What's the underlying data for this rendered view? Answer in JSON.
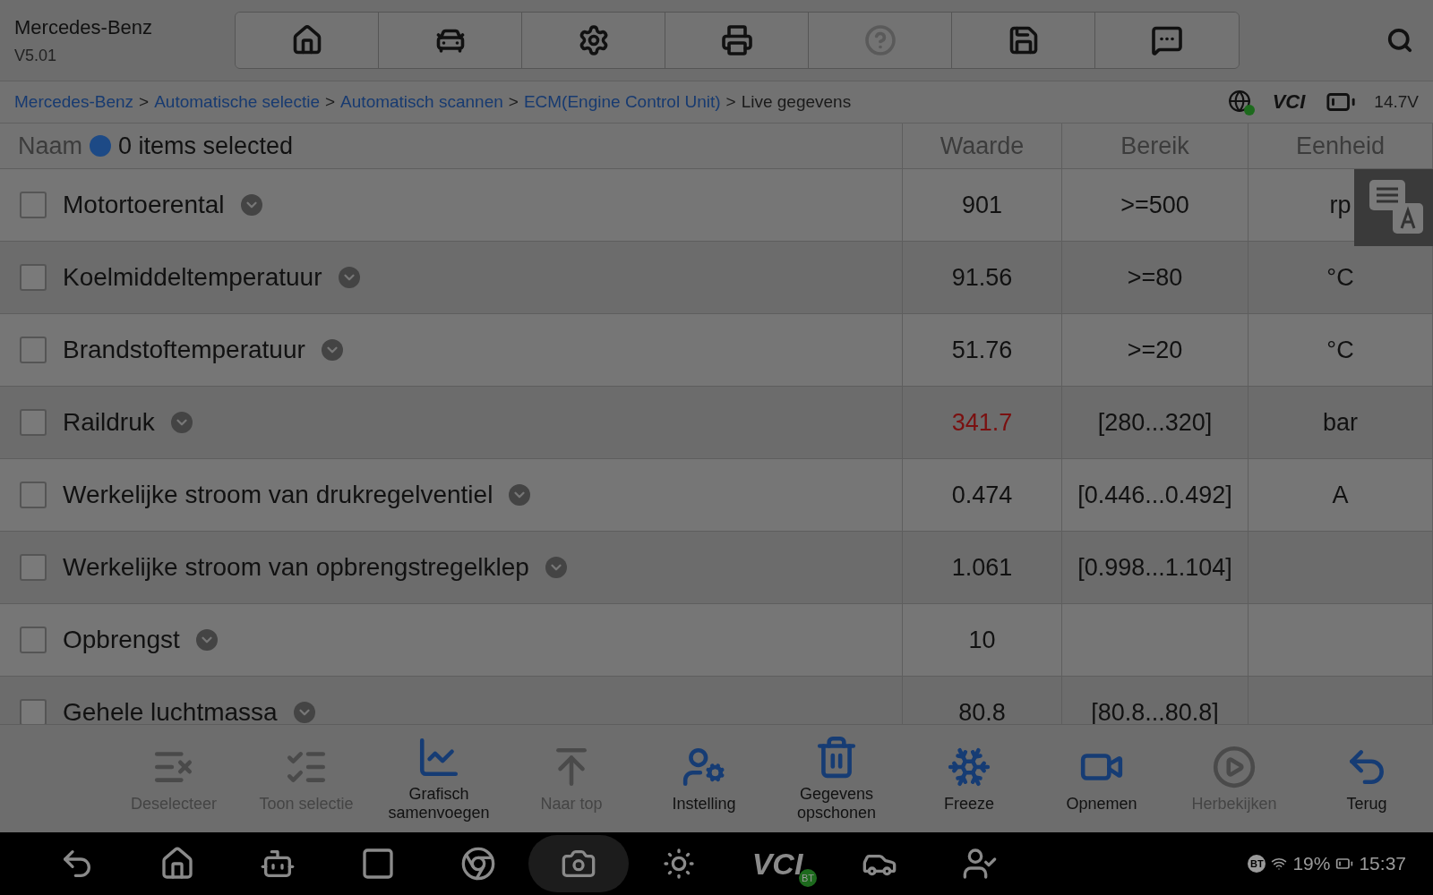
{
  "app": {
    "title": "Mercedes-Benz",
    "version": "V5.01"
  },
  "breadcrumb": {
    "links": [
      "Mercedes-Benz",
      "Automatische selectie",
      "Automatisch scannen",
      "ECM(Engine Control Unit)"
    ],
    "current": "Live gegevens",
    "separator": ">"
  },
  "status": {
    "vci": "VCI",
    "voltage": "14.7V"
  },
  "table": {
    "columns": [
      "Naam",
      "Waarde",
      "Bereik",
      "Eenheid"
    ],
    "selection_info": "0 items selected",
    "rows": [
      {
        "name": "Motortoerental",
        "value": "901",
        "range": ">=500",
        "unit": "rp",
        "checked": false,
        "alarm": false
      },
      {
        "name": "Koelmiddeltemperatuur",
        "value": "91.56",
        "range": ">=80",
        "unit": "°C",
        "checked": false,
        "alarm": false
      },
      {
        "name": "Brandstoftemperatuur",
        "value": "51.76",
        "range": ">=20",
        "unit": "°C",
        "checked": false,
        "alarm": false
      },
      {
        "name": "Raildruk",
        "value": "341.7",
        "range": "[280...320]",
        "unit": "bar",
        "checked": false,
        "alarm": true
      },
      {
        "name": "Werkelijke stroom van drukregelventiel",
        "value": "0.474",
        "range": "[0.446...0.492]",
        "unit": "A",
        "checked": false,
        "alarm": false
      },
      {
        "name": "Werkelijke stroom van opbrengstregelklep",
        "value": "1.061",
        "range": "[0.998...1.104]",
        "checked": false,
        "alarm": false
      },
      {
        "name": "Opbrengst",
        "value": "10",
        "checked": false,
        "alarm": false
      },
      {
        "name": "Gehele luchtmassa",
        "value": "80.8",
        "range": "[80.8...80.8]",
        "checked": false,
        "alarm": false
      }
    ]
  },
  "toolbar": [
    {
      "label": "Deselecteer",
      "disabled": true
    },
    {
      "label": "Toon selectie",
      "disabled": true
    },
    {
      "label": "Grafisch samenvoegen",
      "disabled": false
    },
    {
      "label": "Naar top",
      "disabled": true
    },
    {
      "label": "Instelling",
      "disabled": false
    },
    {
      "label": "Gegevens opschonen",
      "disabled": false
    },
    {
      "label": "Freeze",
      "disabled": false
    },
    {
      "label": "Opnemen",
      "disabled": false
    },
    {
      "label": "Herbekijken",
      "disabled": true
    },
    {
      "label": "Terug",
      "disabled": false
    }
  ],
  "system_bar": {
    "vci": "VCI",
    "vci_badge": "BT",
    "bt": "BT",
    "battery": "19%",
    "time": "15:37"
  }
}
